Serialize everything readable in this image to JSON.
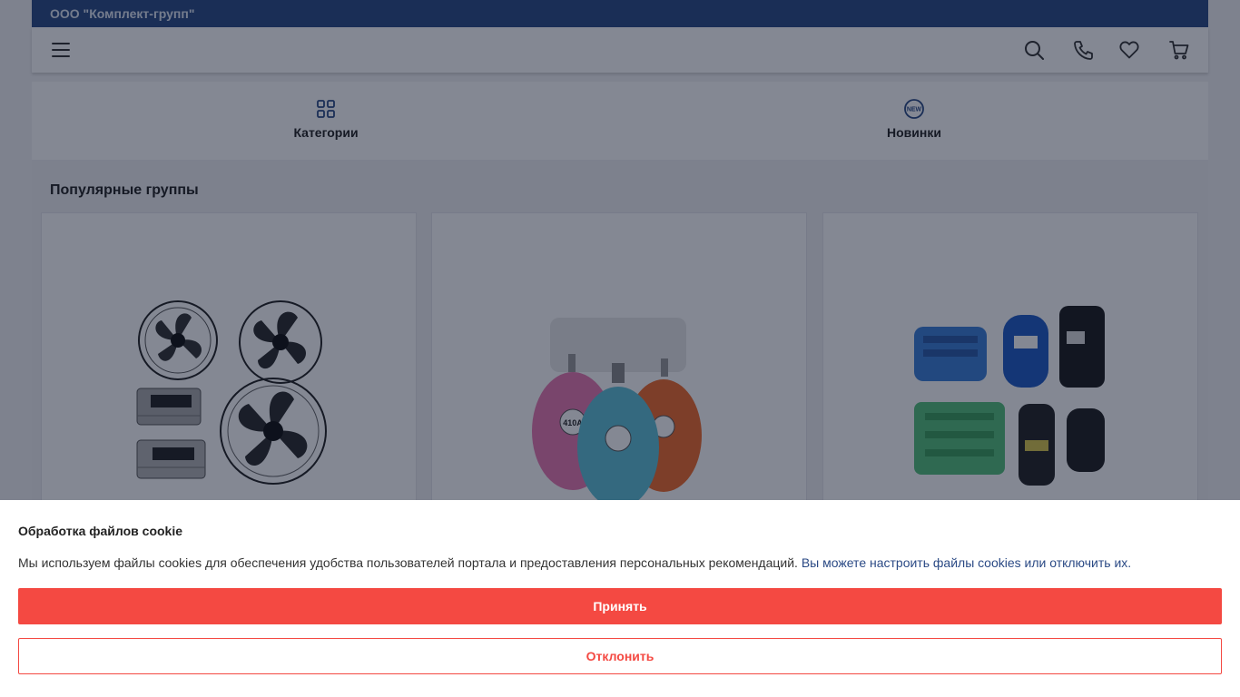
{
  "topbar": {
    "company": "ООО \"Комплект-групп\""
  },
  "header": {
    "icons": [
      "menu-icon",
      "search-icon",
      "phone-icon",
      "heart-icon",
      "cart-icon"
    ]
  },
  "quicknav": {
    "items": [
      {
        "label": "Категории",
        "icon": "grid-icon"
      },
      {
        "label": "Новинки",
        "icon": "new-badge-icon",
        "badge_text": "NEW"
      }
    ]
  },
  "popular": {
    "title": "Популярные группы",
    "cards": [
      {
        "image": "fans-image"
      },
      {
        "image": "refrigerant-cylinders-image",
        "cylinder_label": "410A"
      },
      {
        "image": "compressors-image"
      }
    ]
  },
  "cookie": {
    "title": "Обработка файлов cookie",
    "text": "Мы используем файлы cookies для обеспечения удобства пользователей портала и предоставления персональных рекомендаций.",
    "link": "Вы можете настроить файлы cookies или отключить их.",
    "accept": "Принять",
    "decline": "Отклонить"
  },
  "colors": {
    "topbar": "#2b4a85",
    "accent": "#f44942",
    "link": "#2b4a85"
  }
}
